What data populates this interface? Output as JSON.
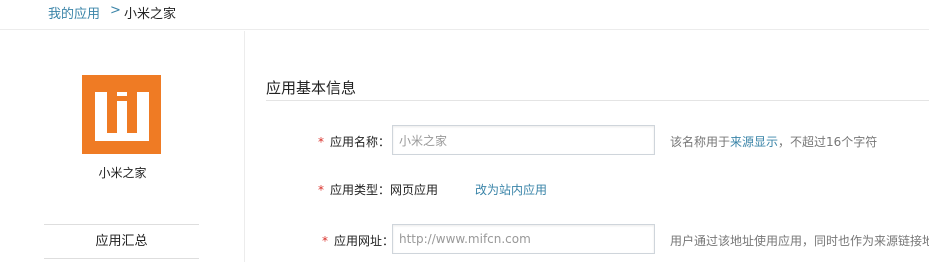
{
  "breadcrumb": {
    "parent": "我的应用",
    "separator": ">",
    "current": "小米之家"
  },
  "sidebar": {
    "app_name": "小米之家",
    "logo_icon": "mi-logo-icon",
    "logo_color": "#ef7b24",
    "nav_items": [
      {
        "label": "应用汇总"
      }
    ]
  },
  "main": {
    "section_title": "应用基本信息",
    "required_mark": "*",
    "fields": {
      "app_name": {
        "label": "应用名称：",
        "value": "小米之家",
        "hint_prefix": "该名称用于",
        "hint_link": "来源显示",
        "hint_suffix": "，不超过16个字符"
      },
      "app_type": {
        "label": "应用类型：",
        "value": "网页应用",
        "action": "改为站内应用"
      },
      "app_url": {
        "label": "应用网址：",
        "placeholder": "http://www.mifcn.com",
        "hint": "用户通过该地址使用应用，同时也作为来源链接地址"
      }
    }
  },
  "colors": {
    "accent_link": "#3a84a8",
    "required": "#d9302a"
  }
}
